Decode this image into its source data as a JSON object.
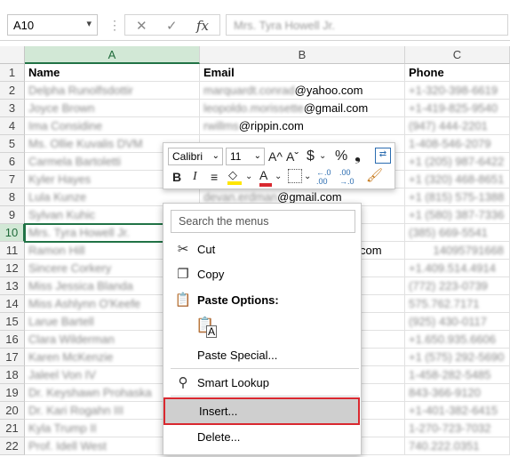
{
  "formula_bar": {
    "name_box": "A10",
    "cancel_icon": "✕",
    "enter_icon": "✓",
    "fx_label": "fx",
    "formula": "Mrs. Tyra Howell Jr."
  },
  "columns": [
    "A",
    "B",
    "C"
  ],
  "rows": [
    {
      "n": "1",
      "name": "Name",
      "email_user": "Email",
      "email_domain": "",
      "phone": "Phone"
    },
    {
      "n": "2",
      "name": "Delpha Runolfsdottir",
      "email_user": "marquardt.conrad",
      "email_domain": "@yahoo.com",
      "phone": "+1-320-398-6619"
    },
    {
      "n": "3",
      "name": "Joyce Brown",
      "email_user": "leopoldo.morissette",
      "email_domain": "@gmail.com",
      "phone": "+1-419-825-9540"
    },
    {
      "n": "4",
      "name": "Ima Considine",
      "email_user": "rwillms",
      "email_domain": "@rippin.com",
      "phone": "(947) 444-2201"
    },
    {
      "n": "5",
      "name": "Ms. Ollie Kuvalis DVM",
      "email_user": "",
      "email_domain": "",
      "phone": "1-408-546-2079"
    },
    {
      "n": "6",
      "name": "Carmela Bartoletti",
      "email_user": "",
      "email_domain": "",
      "phone": "+1 (205) 987-6422"
    },
    {
      "n": "7",
      "name": "Kyler Hayes",
      "email_user": "",
      "email_domain": "",
      "phone": "+1 (320) 468-8651"
    },
    {
      "n": "8",
      "name": "Lula Kunze",
      "email_user": "devan.erdman",
      "email_domain": "@gmail.com",
      "phone": "+1 (815) 575-1388"
    },
    {
      "n": "9",
      "name": "Sylvan Kuhic",
      "email_user": "",
      "email_domain": "",
      "phone": "+1 (580) 387-7336"
    },
    {
      "n": "10",
      "name": "Mrs. Tyra Howell Jr.",
      "email_user": "",
      "email_domain": "",
      "phone": "(385) 669-5541"
    },
    {
      "n": "11",
      "name": "Ramon Hill",
      "email_user": "",
      "email_domain": "com",
      "phone": "14095791668"
    },
    {
      "n": "12",
      "name": "Sincere Corkery",
      "email_user": "",
      "email_domain": "",
      "phone": "+1.409.514.4914"
    },
    {
      "n": "13",
      "name": "Miss Jessica Blanda",
      "email_user": "",
      "email_domain": "",
      "phone": "(772) 223-0739"
    },
    {
      "n": "14",
      "name": "Miss Ashlynn O'Keefe",
      "email_user": "",
      "email_domain": "",
      "phone": "575.762.7171"
    },
    {
      "n": "15",
      "name": "Larue Bartell",
      "email_user": "",
      "email_domain": "",
      "phone": "(925) 430-0117"
    },
    {
      "n": "16",
      "name": "Clara Wilderman",
      "email_user": "",
      "email_domain": "",
      "phone": "+1.650.935.6606"
    },
    {
      "n": "17",
      "name": "Karen McKenzie",
      "email_user": "",
      "email_domain": "",
      "phone": "+1 (575) 292-5690"
    },
    {
      "n": "18",
      "name": "Jaleel Von IV",
      "email_user": "",
      "email_domain": "",
      "phone": "1-458-282-5485"
    },
    {
      "n": "19",
      "name": "Dr. Keyshawn Prohaska",
      "email_user": "",
      "email_domain": "",
      "phone": "843-366-9120"
    },
    {
      "n": "20",
      "name": "Dr. Kari Rogahn III",
      "email_user": "",
      "email_domain": "",
      "phone": "+1-401-382-6415"
    },
    {
      "n": "21",
      "name": "Kyla Trump II",
      "email_user": "",
      "email_domain": "",
      "phone": "1-270-723-7032"
    },
    {
      "n": "22",
      "name": "Prof. Idell West",
      "email_user": "",
      "email_domain": "",
      "phone": "740.222.0351"
    }
  ],
  "mini_toolbar": {
    "font_name": "Calibri",
    "font_size": "11",
    "grow_font": "A^",
    "shrink_font": "Aˇ",
    "currency": "$",
    "percent": "%",
    "comma": "❟",
    "bold": "B",
    "italic": "I",
    "align": "≡",
    "font_color_letter": "A",
    "increase_decimal": "←.0 .00",
    "decrease_decimal": ".00 →.0"
  },
  "context_menu": {
    "search_placeholder": "Search the menus",
    "items": {
      "cut": "Cut",
      "copy": "Copy",
      "paste_options": "Paste Options:",
      "paste_special": "Paste Special...",
      "smart_lookup": "Smart Lookup",
      "insert": "Insert...",
      "delete": "Delete..."
    }
  },
  "colors": {
    "accent": "#217346",
    "highlight_border": "#d9282f",
    "highlight_bg": "#cfcfcf"
  }
}
